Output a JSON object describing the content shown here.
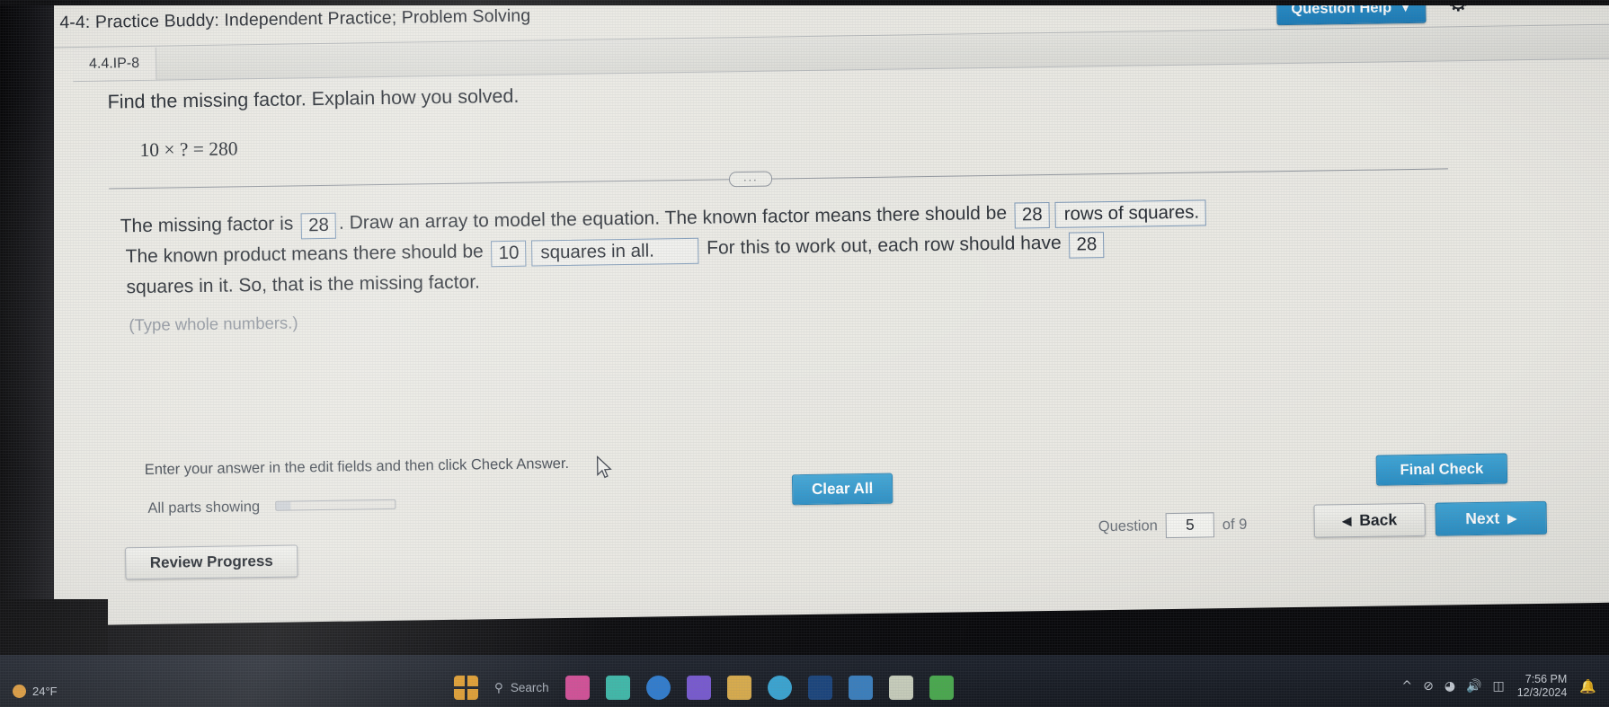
{
  "header": {
    "back_icon": "back-chevron-icon",
    "title": "4-4: Practice Buddy: Independent Practice; Problem Solving",
    "question_help_label": "Question Help",
    "question_help_caret": "▼",
    "gear_icon": "⚙"
  },
  "tab": {
    "label": "4.4.IP-8"
  },
  "problem": {
    "stem": "Find the missing factor. Explain how you solved.",
    "equation": "10 × ? = 280",
    "separator_pill": "···"
  },
  "answer": {
    "seg1": "The missing factor is ",
    "field1": "28",
    "seg2": ". Draw an array to model the equation. The known factor means there should be ",
    "field2": "28",
    "seg3": "",
    "field3": "rows of squares.",
    "seg4": " The known product means there should be ",
    "field4": "10",
    "field5": "squares in all.",
    "seg5": " For this to work out, each row should ",
    "seg6": "have ",
    "field6": "28",
    "seg7": " squares in it. So, that is the missing factor.",
    "type_hint": "(Type whole numbers.)"
  },
  "footer": {
    "hint": "Enter your answer in the edit fields and then click Check Answer.",
    "all_parts": "All parts showing",
    "progress_percent": 12,
    "clear_all_label": "Clear All",
    "final_check_label": "Final Check",
    "review_progress_label": "Review Progress",
    "question_label": "Question",
    "question_number": "5",
    "of_label": "of 9",
    "back_label": "Back",
    "back_icon": "◀",
    "next_label": "Next",
    "next_icon": "▶"
  },
  "taskbar": {
    "weather_temp": "24°F",
    "search_placeholder": "Search",
    "search_icon": "⚲",
    "clock_time": "7:56 PM",
    "clock_date": "12/3/2024",
    "wifi_icon": "◠",
    "volume_icon": "⏵",
    "battery_icon": "▬",
    "notification_icon": "ὑ4",
    "chevron_up_icon": "^",
    "apps": [
      {
        "name": "windows-start-icon",
        "color": "#e8a12c"
      },
      {
        "name": "search-taskbar-icon",
        "color": "#00000000"
      },
      {
        "name": "app-pink-icon",
        "color": "#d9509b"
      },
      {
        "name": "app-teal-icon",
        "color": "#3fbfae"
      },
      {
        "name": "app-blue-icon",
        "color": "#2f7fd4"
      },
      {
        "name": "app-purple-icon",
        "color": "#7a5bd6"
      },
      {
        "name": "app-folder-icon",
        "color": "#e0b14d"
      },
      {
        "name": "app-cyan-icon",
        "color": "#3aa9d8"
      },
      {
        "name": "app-darkblue-icon",
        "color": "#19457f"
      },
      {
        "name": "app-lblue-icon",
        "color": "#3b82c4"
      },
      {
        "name": "app-cream-icon",
        "color": "#cfd5c2"
      },
      {
        "name": "app-green-icon",
        "color": "#4caf50"
      }
    ]
  },
  "colors": {
    "accent_blue": "#2a8ec4",
    "field_border": "#7794b4",
    "screen_bg": "#e9e8e2"
  }
}
